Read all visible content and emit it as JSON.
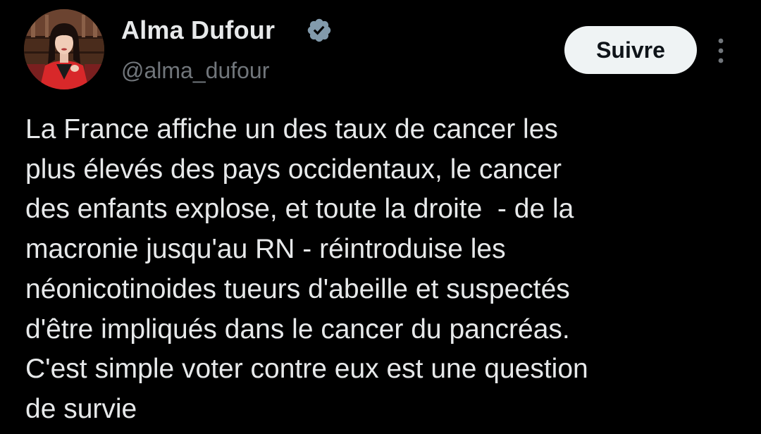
{
  "author": {
    "name": "Alma Dufour",
    "handle": "@alma_dufour",
    "verified": true,
    "verified_icon": "verified-badge-icon"
  },
  "actions": {
    "follow_label": "Suivre",
    "more_icon": "more-options-icon"
  },
  "post": {
    "lines": [
      "La France affiche un des taux de cancer les",
      "plus élevés des pays occidentaux, le cancer",
      "des enfants explose, et toute la droite  - de la",
      "macronie jusqu'au RN - réintroduise les",
      "néonicotinoides tueurs d'abeille et suspectés",
      "d'être impliqués dans le cancer du pancréas.",
      "C'est simple voter contre eux est une question",
      "de survie"
    ]
  },
  "colors": {
    "background": "#000000",
    "text": "#e7e9ea",
    "secondary_text": "#71767b",
    "follow_button_bg": "#eff3f4",
    "follow_button_text": "#0f1419"
  }
}
